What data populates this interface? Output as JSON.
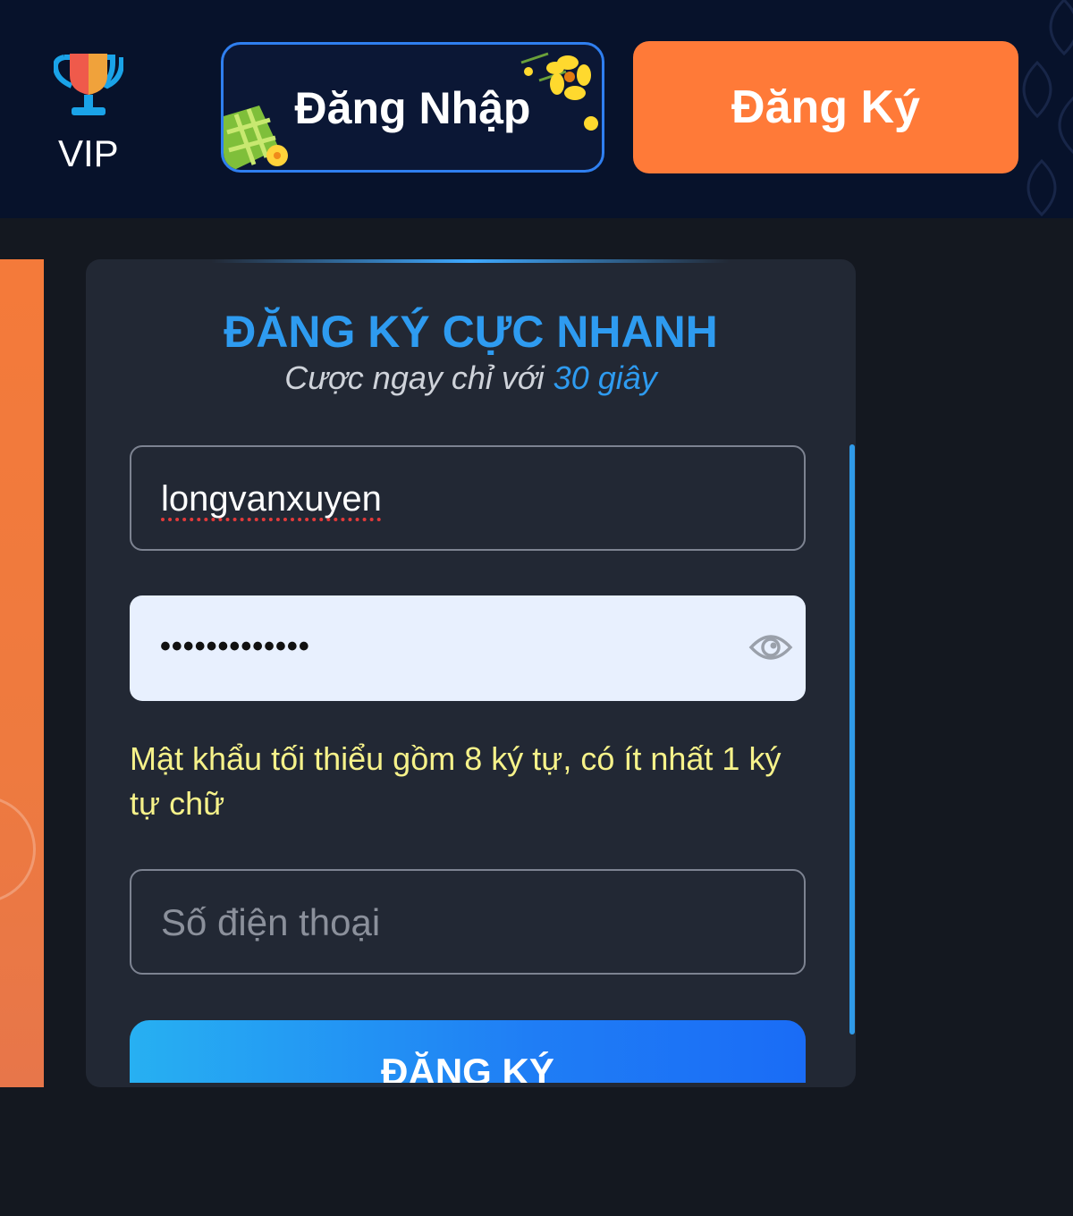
{
  "header": {
    "vip_label": "VIP",
    "login_label": "Đăng Nhập",
    "register_label": "Đăng Ký"
  },
  "form": {
    "title": "ĐĂNG KÝ CỰC NHANH",
    "subtitle_prefix": "Cược ngay chỉ với",
    "subtitle_highlight": "30 giây",
    "username_value": "longvanxuyen",
    "password_value": "•••••••••••••",
    "password_hint": "Mật khẩu tối thiểu gồm 8 ký tự, có ít nhất 1 ký tự chữ",
    "phone_placeholder": "Số điện thoại",
    "submit_label": "ĐĂNG KÝ"
  },
  "colors": {
    "header_bg": "#07122b",
    "accent_orange": "#ff7a38",
    "accent_blue": "#2e9bf0",
    "hint_yellow": "#f6f28a",
    "card_bg": "#222834"
  },
  "icons": [
    "trophy-icon",
    "eye-icon",
    "flower-icon",
    "rice-cake-icon"
  ]
}
